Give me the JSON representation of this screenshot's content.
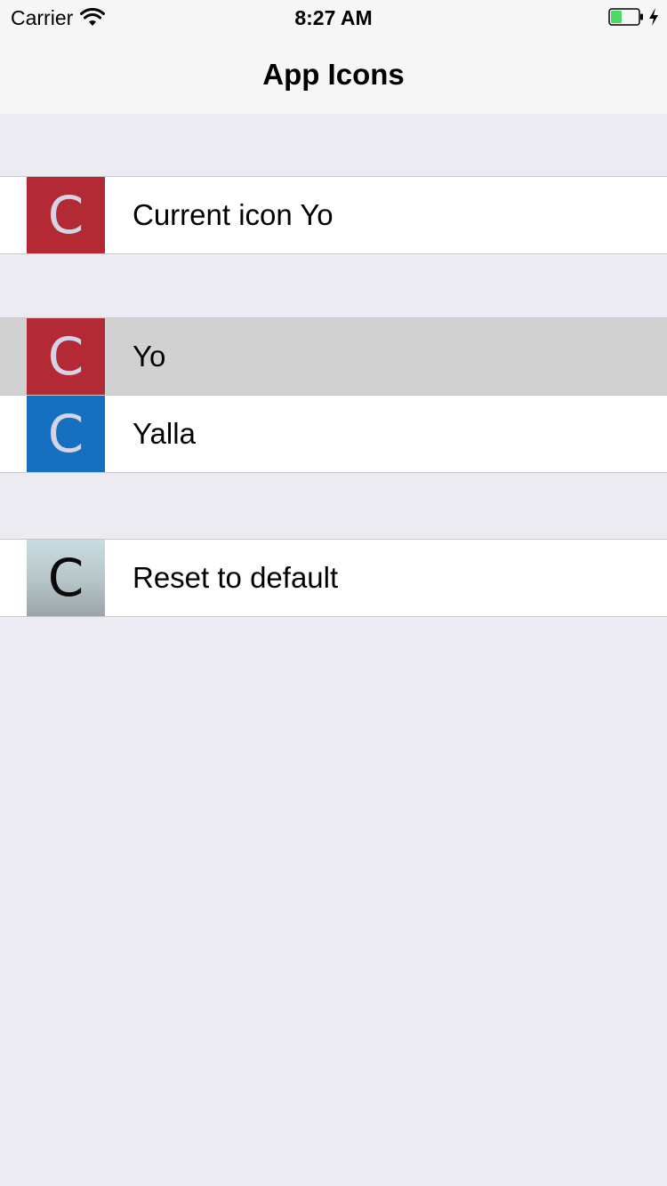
{
  "status_bar": {
    "carrier": "Carrier",
    "time": "8:27 AM",
    "battery_level": 0.4
  },
  "nav": {
    "title": "App Icons"
  },
  "current": {
    "label": "Current icon Yo",
    "icon_letter": "C",
    "icon_color": "#b42a34"
  },
  "icons": [
    {
      "label": "Yo",
      "icon_letter": "C",
      "icon_color": "#b42a34",
      "selected": true
    },
    {
      "label": "Yalla",
      "icon_letter": "C",
      "icon_color": "#1670c0",
      "selected": false
    }
  ],
  "reset": {
    "label": "Reset to default",
    "icon_letter": "C"
  },
  "colors": {
    "background": "#ebebf1",
    "bar": "#f6f6f6",
    "selected_row": "#d1d1d1",
    "battery_fill": "#4cd964"
  }
}
